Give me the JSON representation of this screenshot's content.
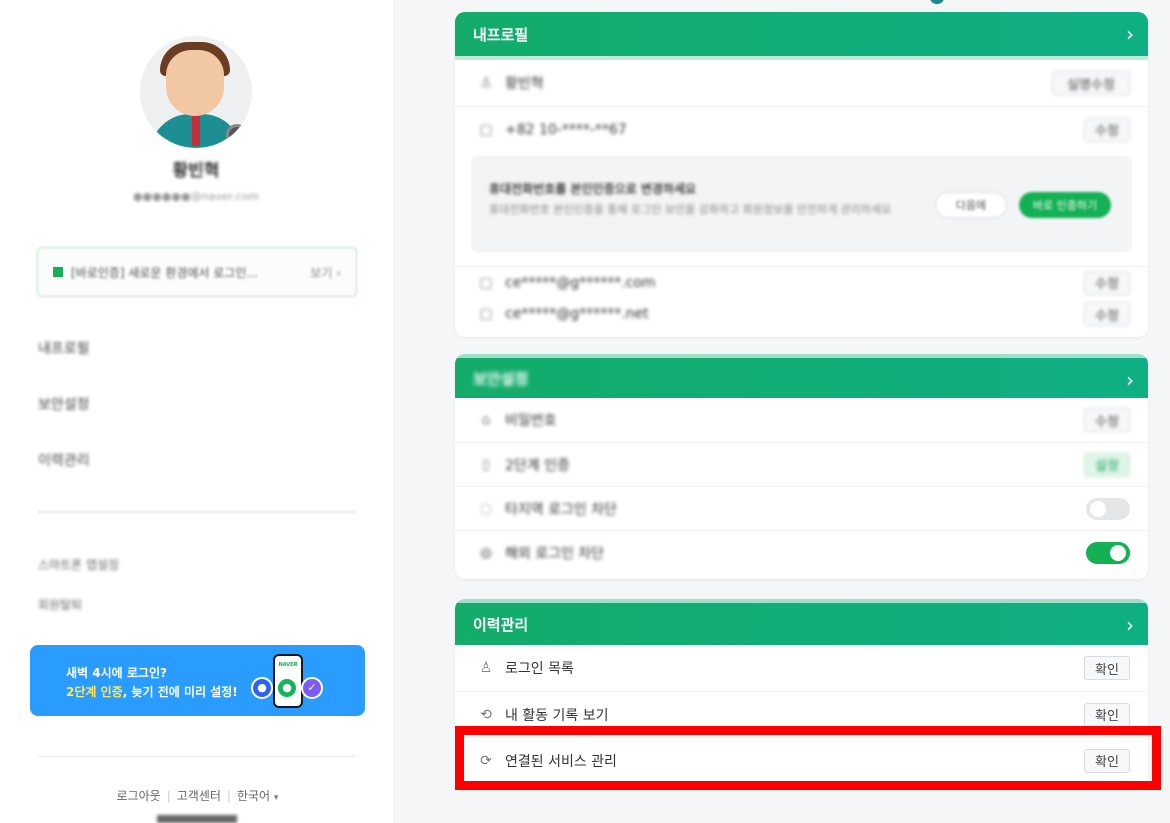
{
  "sidebar": {
    "profile_name": "황빈혁",
    "profile_email": "●●●●●●@naver.com",
    "notice_text": "[바로인증] 새로운 환경에서 로그인...",
    "notice_more": "보기 ›",
    "menu": [
      "내프로필",
      "보안설정",
      "이력관리"
    ],
    "sub_menu": [
      "스마트폰 앱설정",
      "회원탈퇴"
    ],
    "banner": {
      "line1": "새벽 4시에 로그인?",
      "line2_highlight": "2단계 인증",
      "line2_rest": ", 늦기 전에 미리 설정!",
      "phone_label": "NAVER"
    },
    "footer": {
      "logout": "로그아웃",
      "support": "고객센터",
      "language": "한국어",
      "caret": "▾"
    }
  },
  "profile_card": {
    "title": "내프로필",
    "chevron": ">",
    "rows": [
      {
        "icon": "person-icon",
        "glyph": "♙",
        "label": "황빈혁",
        "button": "실명수정"
      },
      {
        "icon": "phone-icon",
        "glyph": "▢",
        "label": "+82 10-****-**67",
        "button": "수정"
      }
    ],
    "notice": {
      "title": "휴대전화번호를 본인인증으로 변경하세요",
      "desc": "휴대전화번호 본인인증을 통해 로그인 보안을 강화하고 회원정보를 안전하게 관리하세요",
      "btn_later": "다음에",
      "btn_verify": "바로 인증하기"
    },
    "email_rows": [
      {
        "icon": "mail-icon",
        "glyph": "▢",
        "label": "ce*****@g******.com",
        "button": "수정"
      },
      {
        "icon": "mail-icon",
        "glyph": "▢",
        "label": "ce*****@g******.net",
        "button": "수정"
      }
    ]
  },
  "security_card": {
    "title": "보안설정",
    "chevron": ">",
    "rows": [
      {
        "icon": "lock-icon",
        "glyph": "⌂",
        "label": "비밀번호",
        "control": "수정"
      },
      {
        "icon": "shield-icon",
        "glyph": "▯",
        "label": "2단계 인증",
        "control": "설정"
      },
      {
        "icon": "globe-icon",
        "glyph": "◌",
        "label": "타지역 로그인 차단",
        "toggle": "off"
      },
      {
        "icon": "alert-icon",
        "glyph": "◍",
        "label": "해외 로그인 차단",
        "toggle": "on"
      }
    ]
  },
  "history_card": {
    "title": "이력관리",
    "chevron": ">",
    "rows": [
      {
        "icon": "login-list-icon",
        "glyph": "♙",
        "label": "로그인 목록",
        "button": "확인"
      },
      {
        "icon": "history-icon",
        "glyph": "⟲",
        "label": "내 활동 기록 보기",
        "button": "확인"
      },
      {
        "icon": "connected-service-icon",
        "glyph": "⟳",
        "label": "연결된 서비스 관리",
        "button": "확인"
      }
    ]
  },
  "colors": {
    "brand_green": "#13ac6a",
    "banner_blue": "#2a9bff",
    "highlight_red": "#ff0000"
  }
}
